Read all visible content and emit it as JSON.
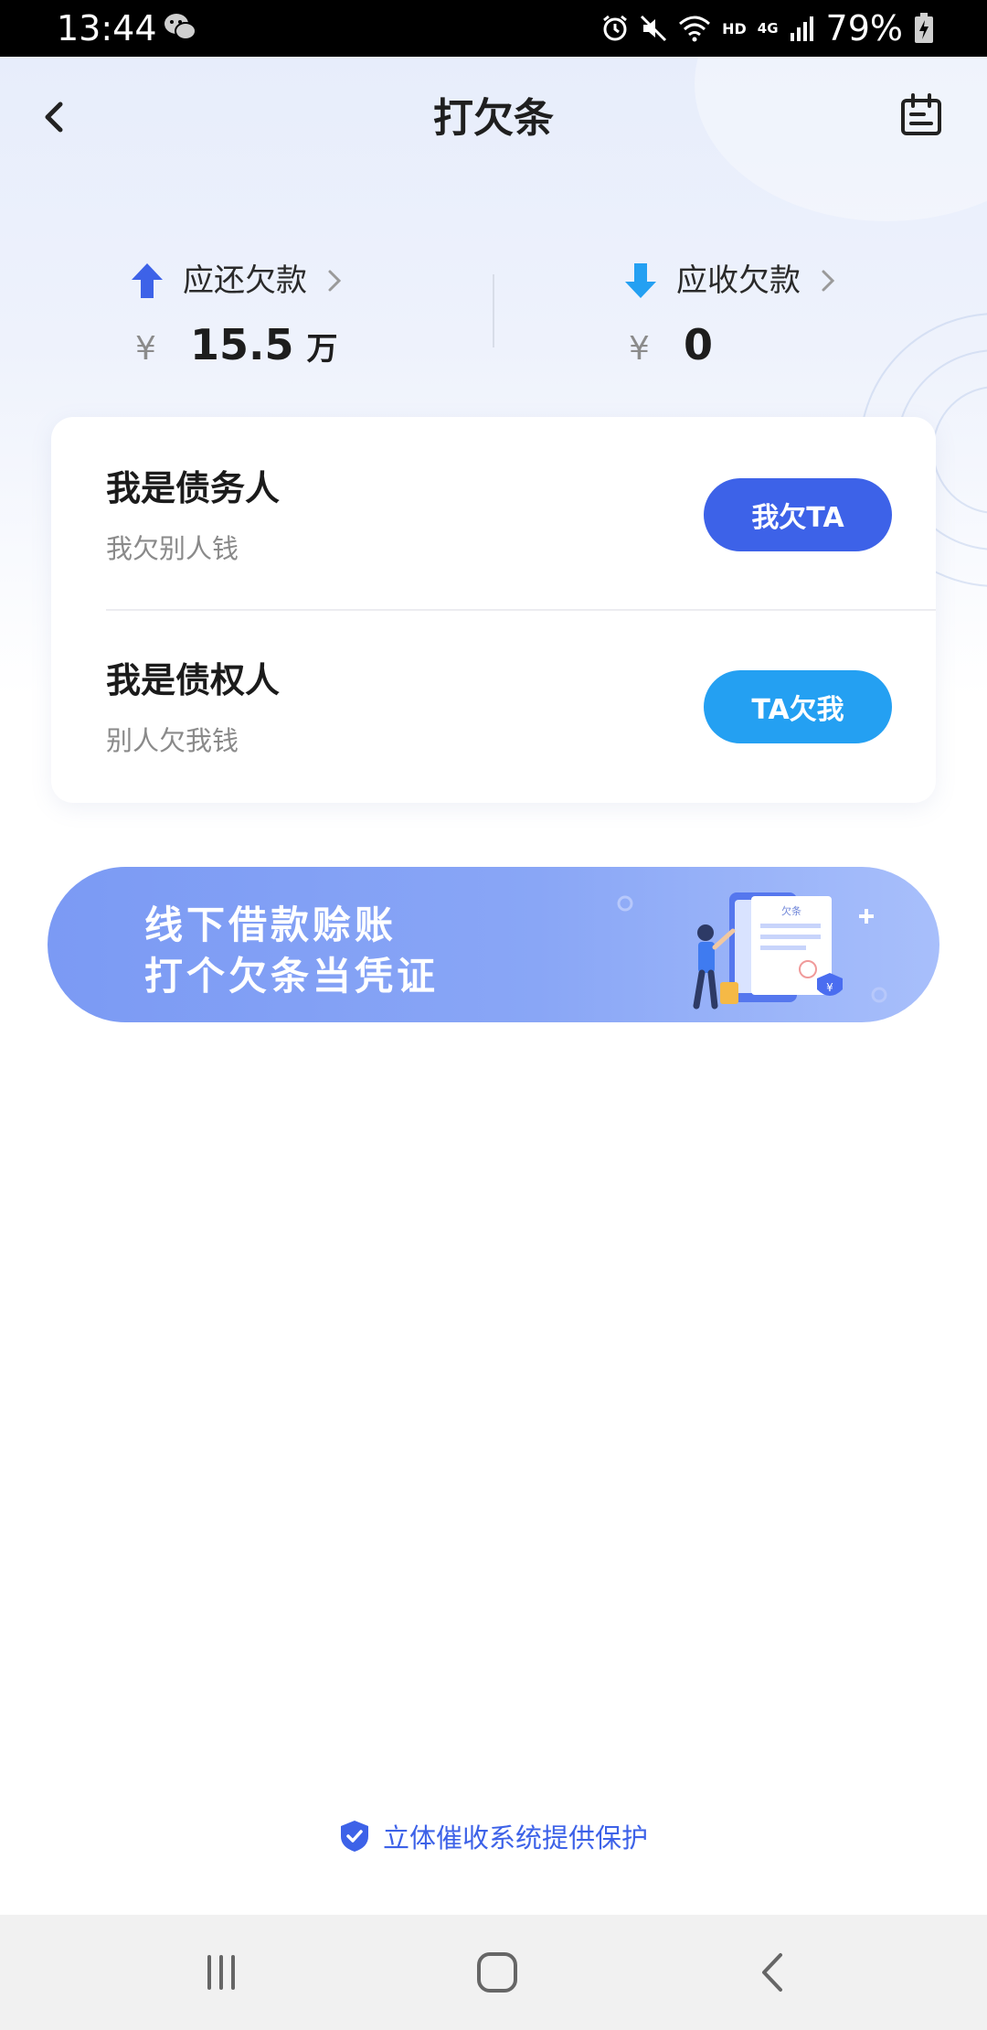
{
  "status_bar": {
    "time": "13:44",
    "network_hd": "HD",
    "network_4g": "4G",
    "battery": "79%"
  },
  "nav": {
    "title": "打欠条"
  },
  "summary": {
    "payable": {
      "label": "应还欠款",
      "currency": "¥",
      "amount": "15.5",
      "unit": "万",
      "arrow_color": "#3d62e8"
    },
    "receivable": {
      "label": "应收欠款",
      "currency": "¥",
      "amount": "0",
      "arrow_color": "#24a0f2"
    }
  },
  "roles": [
    {
      "title": "我是债务人",
      "subtitle": "我欠别人钱",
      "button": "我欠TA",
      "button_color": "#3d62e8"
    },
    {
      "title": "我是债权人",
      "subtitle": "别人欠我钱",
      "button": "TA欠我",
      "button_color": "#24a0f2"
    }
  ],
  "banner": {
    "line1": "线下借款赊账",
    "line2": "打个欠条当凭证",
    "illustration_text": "欠条"
  },
  "footer": {
    "protection_text": "立体催收系统提供保护"
  },
  "colors": {
    "primary": "#3d62e8",
    "secondary": "#24a0f2"
  }
}
